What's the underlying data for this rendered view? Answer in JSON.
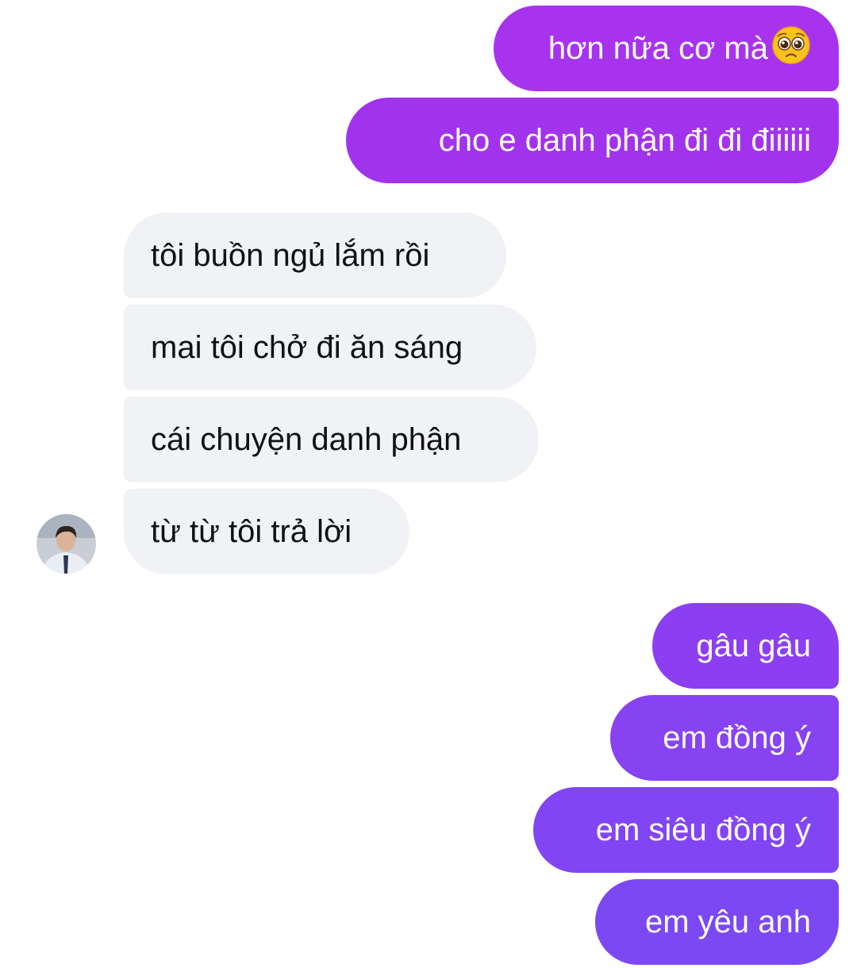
{
  "thread": {
    "group1_outgoing": [
      {
        "text": "hơn nữa cơ mà",
        "emoji": "pleading-face-emoji",
        "color": "#a833ee"
      },
      {
        "text": "cho e danh phận đi đi điiiiii",
        "color": "#a233ec"
      }
    ],
    "incoming": [
      {
        "text": "tôi buồn ngủ lắm rồi"
      },
      {
        "text": "mai tôi chở đi ăn sáng"
      },
      {
        "text": "cái chuyện danh phận"
      },
      {
        "text": "từ từ tôi trả lời"
      }
    ],
    "group2_outgoing": [
      {
        "text": "gâu gâu",
        "color": "#8c3ff2"
      },
      {
        "text": "em đồng ý",
        "color": "#8742f2"
      },
      {
        "text": "em siêu đồng ý",
        "color": "#8245f3"
      },
      {
        "text": "em yêu anh",
        "color": "#7c48f4"
      }
    ]
  },
  "colors": {
    "incoming_bubble": "#f0f2f5",
    "incoming_text": "#101114",
    "outgoing_text": "#ffffff"
  },
  "avatar": {
    "icon": "contact-avatar"
  }
}
